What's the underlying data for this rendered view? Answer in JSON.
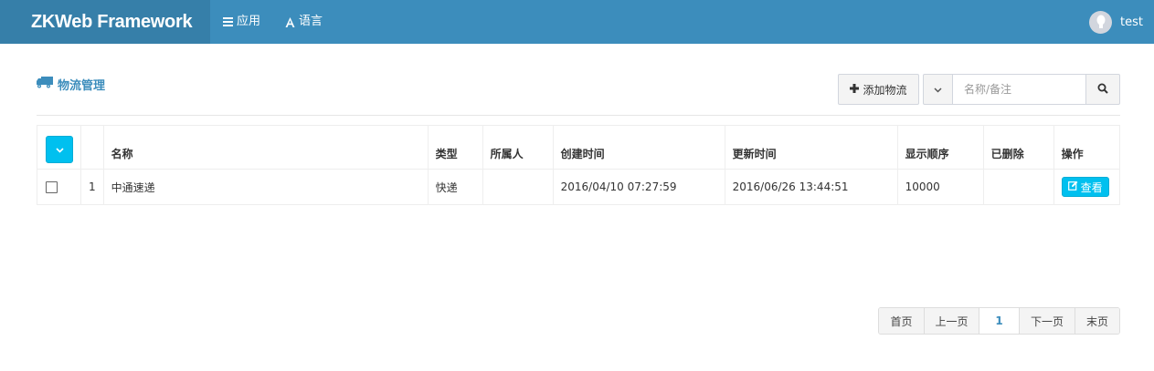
{
  "app": {
    "brand": "ZKWeb Framework"
  },
  "nav": {
    "apps_label": "应用",
    "lang_label": "语言"
  },
  "user": {
    "name": "test"
  },
  "page": {
    "title": "物流管理"
  },
  "toolbar": {
    "add_label": "添加物流",
    "search_placeholder": "名称/备注"
  },
  "table": {
    "headers": [
      "名称",
      "类型",
      "所属人",
      "创建时间",
      "更新时间",
      "显示顺序",
      "已删除",
      "操作"
    ],
    "rows": [
      {
        "index": "1",
        "name": "中通速递",
        "type": "快递",
        "owner": "",
        "created": "2016/04/10 07:27:59",
        "updated": "2016/06/26 13:44:51",
        "order": "10000",
        "deleted": "",
        "action_label": "查看"
      }
    ]
  },
  "pagination": {
    "first": "首页",
    "prev": "上一页",
    "current": "1",
    "next": "下一页",
    "last": "末页"
  },
  "colors": {
    "navbar": "#3c8dbc",
    "brand_bg": "#367fa9",
    "info": "#00c0ef",
    "title": "#3c8dbc"
  },
  "icons": {
    "apps": "bars-icon",
    "lang": "font-icon",
    "page": "truck-icon",
    "add": "plus-icon",
    "search": "search-icon",
    "view": "edit-icon"
  }
}
